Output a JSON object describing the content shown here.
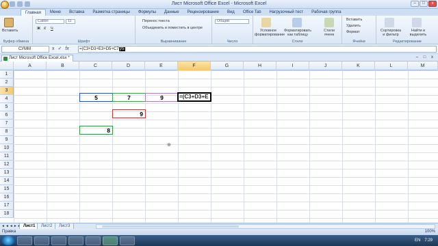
{
  "window": {
    "title": "Лист Microsoft Office Excel - Microsoft Excel",
    "controls": [
      "–",
      "□",
      "x"
    ]
  },
  "ribbon_tabs": [
    "Главная",
    "Меню",
    "Вставка",
    "Разметка страницы",
    "Формулы",
    "Данные",
    "Рецензирование",
    "Вид",
    "Office Tab",
    "Нагрузочный тест",
    "Рабочая группа"
  ],
  "ribbon": {
    "clipboard": {
      "label": "Буфер обмена",
      "paste": "Вставить"
    },
    "font": {
      "label": "Шрифт",
      "font_name": "Calibri",
      "font_size": "11"
    },
    "alignment": {
      "label": "Выравнивание",
      "wrap": "Перенос текста",
      "merge": "Объединить и поместить в центре"
    },
    "number": {
      "label": "Число",
      "format": "Общий"
    },
    "styles": {
      "label": "Стили",
      "cond": "Условное форматирование",
      "table": "Форматировать как таблицу",
      "cell": "Стили ячеек"
    },
    "cells": {
      "label": "Ячейки",
      "insert": "Вставить",
      "delete": "Удалить",
      "format": "Формат"
    },
    "editing": {
      "label": "Редактирование",
      "sort": "Сортировка и фильтр",
      "find": "Найти и выделить"
    }
  },
  "formula_bar": {
    "name_box": "СУММ",
    "formula_prefix": "=(C3+D3+E3+D5+C7",
    "formula_selected": ")/5",
    "fx_symbols": [
      "x",
      "✓",
      "fx"
    ]
  },
  "document_tab": "Лист Microsoft Office Excel.xlsx *",
  "grid": {
    "columns": [
      "A",
      "B",
      "C",
      "D",
      "E",
      "F",
      "G",
      "H",
      "I",
      "J",
      "K",
      "L",
      "M"
    ],
    "selected_column": "F",
    "rows": [
      "1",
      "2",
      "3",
      "4",
      "5",
      "6",
      "7",
      "8",
      "9",
      "10",
      "11",
      "12",
      "13",
      "14",
      "15",
      "16",
      "17",
      "18"
    ],
    "selected_row": "3",
    "cells": {
      "C3": "5",
      "D3": "7",
      "E3": "9",
      "D5": "9",
      "C7": "8",
      "F3": "=(C3+D3+E"
    }
  },
  "sheets": [
    "Лист1",
    "Лист2",
    "Лист3"
  ],
  "status": {
    "mode": "Правка",
    "zoom": "100%"
  },
  "taskbar": {
    "lang": "EN",
    "time": "7:29"
  }
}
